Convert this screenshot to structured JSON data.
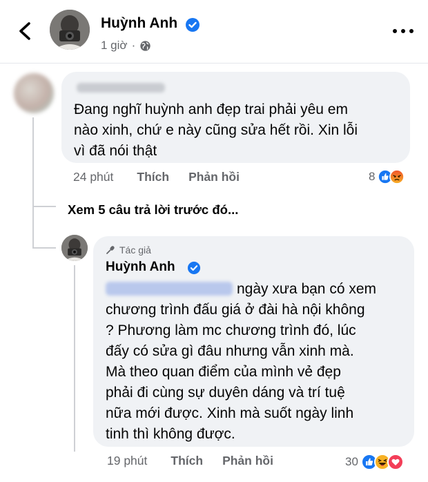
{
  "header": {
    "name": "Huỳnh Anh",
    "time": "1 giờ",
    "back_icon": "chevron-left-icon",
    "more_icon": "more-horizontal-icon",
    "verified_color": "#1877f2"
  },
  "comment": {
    "text": "Đang nghĩ huỳnh anh đẹp trai phải yêu em\nnào xinh, chứ e này cũng sửa hết rồi. Xin lỗi\nvì đã nói thật",
    "time": "24 phút",
    "like_label": "Thích",
    "reply_label": "Phản hồi",
    "reaction_count": "8",
    "reactions": [
      "like",
      "angry"
    ]
  },
  "view_replies": "Xem 5 câu trả lời trước đó...",
  "reply": {
    "badge": "Tác giả",
    "name": "Huỳnh Anh",
    "text_first": "ngày xưa bạn có xem",
    "text_rest": "chương trình đấu giá ở đài hà nội không\n? Phương làm mc chương trình đó, lúc\nđấy có sửa gì đâu nhưng vẫn xinh mà.\nMà theo quan điểm của mình vẻ đẹp\nphải đi cùng sự duyên dáng và trí tuệ\nnữa mới được. Xinh mà suốt ngày linh\ntinh thì không được.",
    "time": "19 phút",
    "like_label": "Thích",
    "reply_label": "Phản hồi",
    "reaction_count": "30",
    "reactions": [
      "like",
      "haha",
      "love"
    ]
  },
  "colors": {
    "bubble": "#f0f2f5",
    "secondary_text": "#65676b",
    "like_blue": "#1877f2",
    "angry_orange": "#f0512b",
    "haha_yellow": "#f7b125",
    "love_red": "#f33e58"
  }
}
